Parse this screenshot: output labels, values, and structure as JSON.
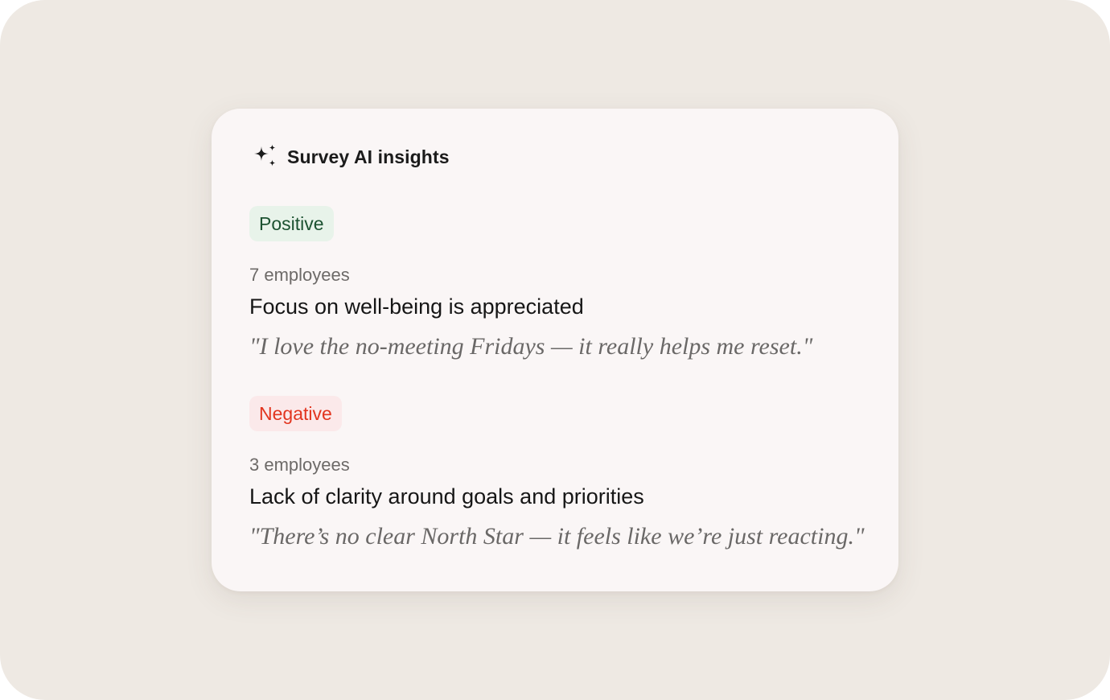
{
  "card": {
    "title": "Survey AI insights",
    "icon": "sparkles-icon"
  },
  "insights": [
    {
      "sentiment": "Positive",
      "sentiment_color": "#1c5231",
      "sentiment_bg": "#e8f3ea",
      "count": "7 employees",
      "title": "Focus on well-being is appreciated",
      "quote": "\"I love the no-meeting Fridays — it really helps me reset.\""
    },
    {
      "sentiment": "Negative",
      "sentiment_color": "#e2351f",
      "sentiment_bg": "#fbe9ea",
      "count": "3 employees",
      "title": "Lack of clarity around goals and priorities",
      "quote": "\"There’s no clear North Star — it feels like we’re just reacting.\""
    }
  ]
}
